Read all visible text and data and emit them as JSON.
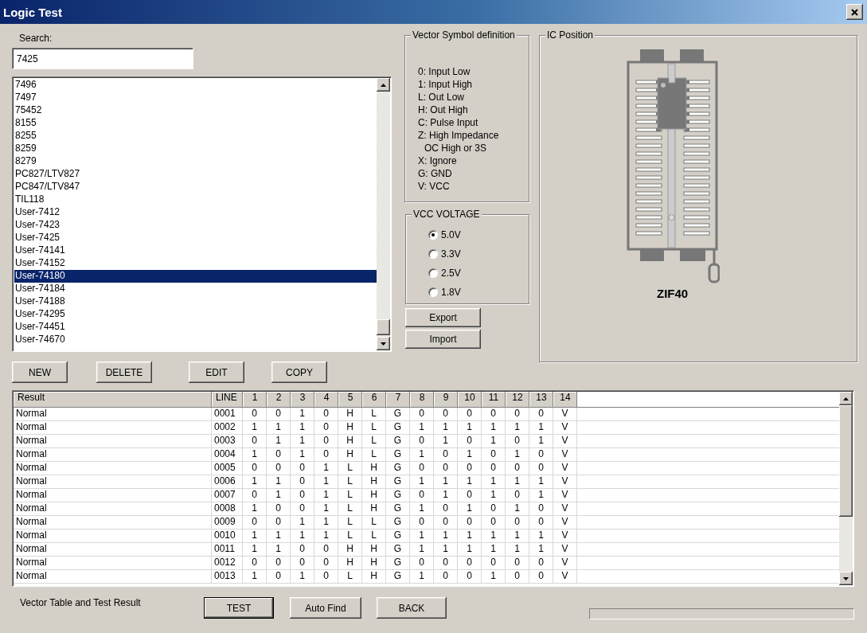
{
  "window": {
    "title": "Logic Test"
  },
  "search": {
    "label": "Search:",
    "value": "7425"
  },
  "device_list": {
    "items": [
      {
        "label": "7496",
        "selected": false
      },
      {
        "label": "7497",
        "selected": false
      },
      {
        "label": "75452",
        "selected": false
      },
      {
        "label": "8155",
        "selected": false
      },
      {
        "label": "8255",
        "selected": false
      },
      {
        "label": "8259",
        "selected": false
      },
      {
        "label": "8279",
        "selected": false
      },
      {
        "label": "PC827/LTV827",
        "selected": false
      },
      {
        "label": "PC847/LTV847",
        "selected": false
      },
      {
        "label": "TIL118",
        "selected": false
      },
      {
        "label": "User-7412",
        "selected": false
      },
      {
        "label": "User-7423",
        "selected": false
      },
      {
        "label": "User-7425",
        "selected": false
      },
      {
        "label": "User-74141",
        "selected": false
      },
      {
        "label": "User-74152",
        "selected": false
      },
      {
        "label": "User-74180",
        "selected": true
      },
      {
        "label": "User-74184",
        "selected": false
      },
      {
        "label": "User-74188",
        "selected": false
      },
      {
        "label": "User-74295",
        "selected": false
      },
      {
        "label": "User-74451",
        "selected": false
      },
      {
        "label": "User-74670",
        "selected": false
      }
    ]
  },
  "list_buttons": [
    "NEW",
    "DELETE",
    "EDIT",
    "COPY"
  ],
  "vector_symbols": {
    "title": "Vector Symbol definition",
    "lines": [
      {
        "kind": "entry",
        "text": "0: Input Low"
      },
      {
        "kind": "entry",
        "text": "1: Input High"
      },
      {
        "kind": "entry",
        "text": "L: Out Low"
      },
      {
        "kind": "entry",
        "text": "H: Out High"
      },
      {
        "kind": "entry",
        "text": "C: Pulse Input"
      },
      {
        "kind": "entry",
        "text": "Z: High Impedance"
      },
      {
        "kind": "continuation",
        "text": "OC High or 3S"
      },
      {
        "kind": "entry",
        "text": "X: Ignore"
      },
      {
        "kind": "entry",
        "text": "G: GND"
      },
      {
        "kind": "entry",
        "text": "V: VCC"
      }
    ]
  },
  "vcc_voltage": {
    "title": "VCC VOLTAGE",
    "options": [
      {
        "label": "5.0V",
        "selected": true
      },
      {
        "label": "3.3V",
        "selected": false
      },
      {
        "label": "2.5V",
        "selected": false
      },
      {
        "label": "1.8V",
        "selected": false
      }
    ]
  },
  "file_buttons": [
    "Export",
    "Import"
  ],
  "ic_position": {
    "title": "IC Position",
    "socket": "ZIF40"
  },
  "table": {
    "columns": [
      "Result",
      "LINE",
      "1",
      "2",
      "3",
      "4",
      "5",
      "6",
      "7",
      "8",
      "9",
      "10",
      "11",
      "12",
      "13",
      "14"
    ],
    "rows": [
      {
        "cells": [
          "Normal",
          "0001",
          "0",
          "0",
          "1",
          "0",
          "H",
          "L",
          "G",
          "0",
          "0",
          "0",
          "0",
          "0",
          "0",
          "V"
        ]
      },
      {
        "cells": [
          "Normal",
          "0002",
          "1",
          "1",
          "1",
          "0",
          "H",
          "L",
          "G",
          "1",
          "1",
          "1",
          "1",
          "1",
          "1",
          "V"
        ]
      },
      {
        "cells": [
          "Normal",
          "0003",
          "0",
          "1",
          "1",
          "0",
          "H",
          "L",
          "G",
          "0",
          "1",
          "0",
          "1",
          "0",
          "1",
          "V"
        ]
      },
      {
        "cells": [
          "Normal",
          "0004",
          "1",
          "0",
          "1",
          "0",
          "H",
          "L",
          "G",
          "1",
          "0",
          "1",
          "0",
          "1",
          "0",
          "V"
        ]
      },
      {
        "cells": [
          "Normal",
          "0005",
          "0",
          "0",
          "0",
          "1",
          "L",
          "H",
          "G",
          "0",
          "0",
          "0",
          "0",
          "0",
          "0",
          "V"
        ]
      },
      {
        "cells": [
          "Normal",
          "0006",
          "1",
          "1",
          "0",
          "1",
          "L",
          "H",
          "G",
          "1",
          "1",
          "1",
          "1",
          "1",
          "1",
          "V"
        ]
      },
      {
        "cells": [
          "Normal",
          "0007",
          "0",
          "1",
          "0",
          "1",
          "L",
          "H",
          "G",
          "0",
          "1",
          "0",
          "1",
          "0",
          "1",
          "V"
        ]
      },
      {
        "cells": [
          "Normal",
          "0008",
          "1",
          "0",
          "0",
          "1",
          "L",
          "H",
          "G",
          "1",
          "0",
          "1",
          "0",
          "1",
          "0",
          "V"
        ]
      },
      {
        "cells": [
          "Normal",
          "0009",
          "0",
          "0",
          "1",
          "1",
          "L",
          "L",
          "G",
          "0",
          "0",
          "0",
          "0",
          "0",
          "0",
          "V"
        ]
      },
      {
        "cells": [
          "Normal",
          "0010",
          "1",
          "1",
          "1",
          "1",
          "L",
          "L",
          "G",
          "1",
          "1",
          "1",
          "1",
          "1",
          "1",
          "V"
        ]
      },
      {
        "cells": [
          "Normal",
          "0011",
          "1",
          "1",
          "0",
          "0",
          "H",
          "H",
          "G",
          "1",
          "1",
          "1",
          "1",
          "1",
          "1",
          "V"
        ]
      },
      {
        "cells": [
          "Normal",
          "0012",
          "0",
          "0",
          "0",
          "0",
          "H",
          "H",
          "G",
          "0",
          "0",
          "0",
          "0",
          "0",
          "0",
          "V"
        ]
      },
      {
        "cells": [
          "Normal",
          "0013",
          "1",
          "0",
          "1",
          "0",
          "L",
          "H",
          "G",
          "1",
          "0",
          "0",
          "1",
          "0",
          "0",
          "V"
        ]
      }
    ]
  },
  "footer": {
    "caption": "Vector Table and Test Result",
    "buttons": [
      {
        "label": "TEST",
        "default": true
      },
      {
        "label": "Auto Find",
        "default": false
      },
      {
        "label": "BACK",
        "default": false
      }
    ],
    "progress": {
      "level": 0
    }
  }
}
